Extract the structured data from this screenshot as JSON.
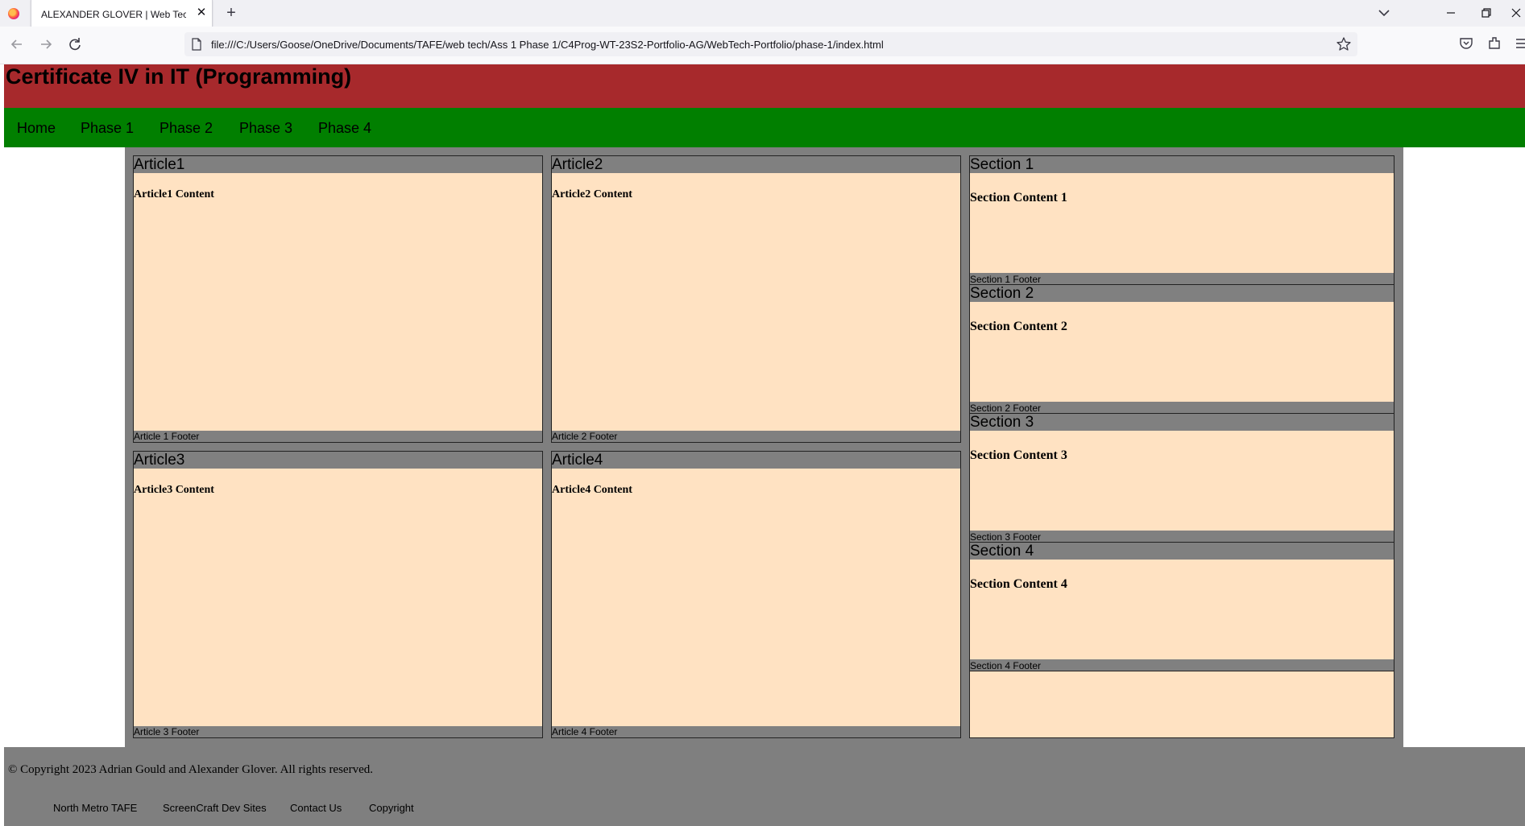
{
  "browser": {
    "tab_title": "ALEXANDER GLOVER | Web Tech | C",
    "url": "file:///C:/Users/Goose/OneDrive/Documents/TAFE/web tech/Ass 1 Phase 1/C4Prog-WT-23S2-Portfolio-AG/WebTech-Portfolio/phase-1/index.html",
    "icons": [
      "firefox-logo",
      "close-icon",
      "plus-icon",
      "chevron-down-icon",
      "minimize-icon",
      "restore-icon",
      "close-icon",
      "back-arrow-icon",
      "forward-arrow-icon",
      "reload-icon",
      "page-icon",
      "star-icon",
      "pocket-icon",
      "extensions-icon",
      "menu-icon"
    ]
  },
  "header": {
    "title": "Certificate IV in IT (Programming)"
  },
  "nav": {
    "items": [
      {
        "label": "Home"
      },
      {
        "label": "Phase 1"
      },
      {
        "label": "Phase 2"
      },
      {
        "label": "Phase 3"
      },
      {
        "label": "Phase 4"
      }
    ]
  },
  "articles": [
    {
      "title": "Article1",
      "content": "Article1 Content",
      "footer": "Article 1 Footer"
    },
    {
      "title": "Article2",
      "content": "Article2 Content",
      "footer": "Article 2 Footer"
    },
    {
      "title": "Article3",
      "content": "Article3 Content",
      "footer": "Article 3 Footer"
    },
    {
      "title": "Article4",
      "content": "Article4 Content",
      "footer": "Article 4 Footer"
    }
  ],
  "sections": [
    {
      "title": "Section 1",
      "content": "Section Content 1",
      "footer": "Section 1 Footer"
    },
    {
      "title": "Section 2",
      "content": "Section Content 2",
      "footer": "Section 2 Footer"
    },
    {
      "title": "Section 3",
      "content": "Section Content 3",
      "footer": "Section 3 Footer"
    },
    {
      "title": "Section 4",
      "content": "Section Content 4",
      "footer": "Section 4 Footer"
    }
  ],
  "footer": {
    "copyright": "© Copyright 2023 Adrian Gould and Alexander Glover. All rights reserved.",
    "links": [
      {
        "label": "North Metro TAFE"
      },
      {
        "label": "ScreenCraft Dev Sites"
      },
      {
        "label": "Contact Us"
      },
      {
        "label": "Copyright"
      }
    ]
  },
  "colors": {
    "header_bg": "#a7292c",
    "nav_bg": "#017f00",
    "main_bg": "#7f7f7f",
    "card_bg": "#ffe2c2",
    "card_head_bg": "#808080"
  }
}
